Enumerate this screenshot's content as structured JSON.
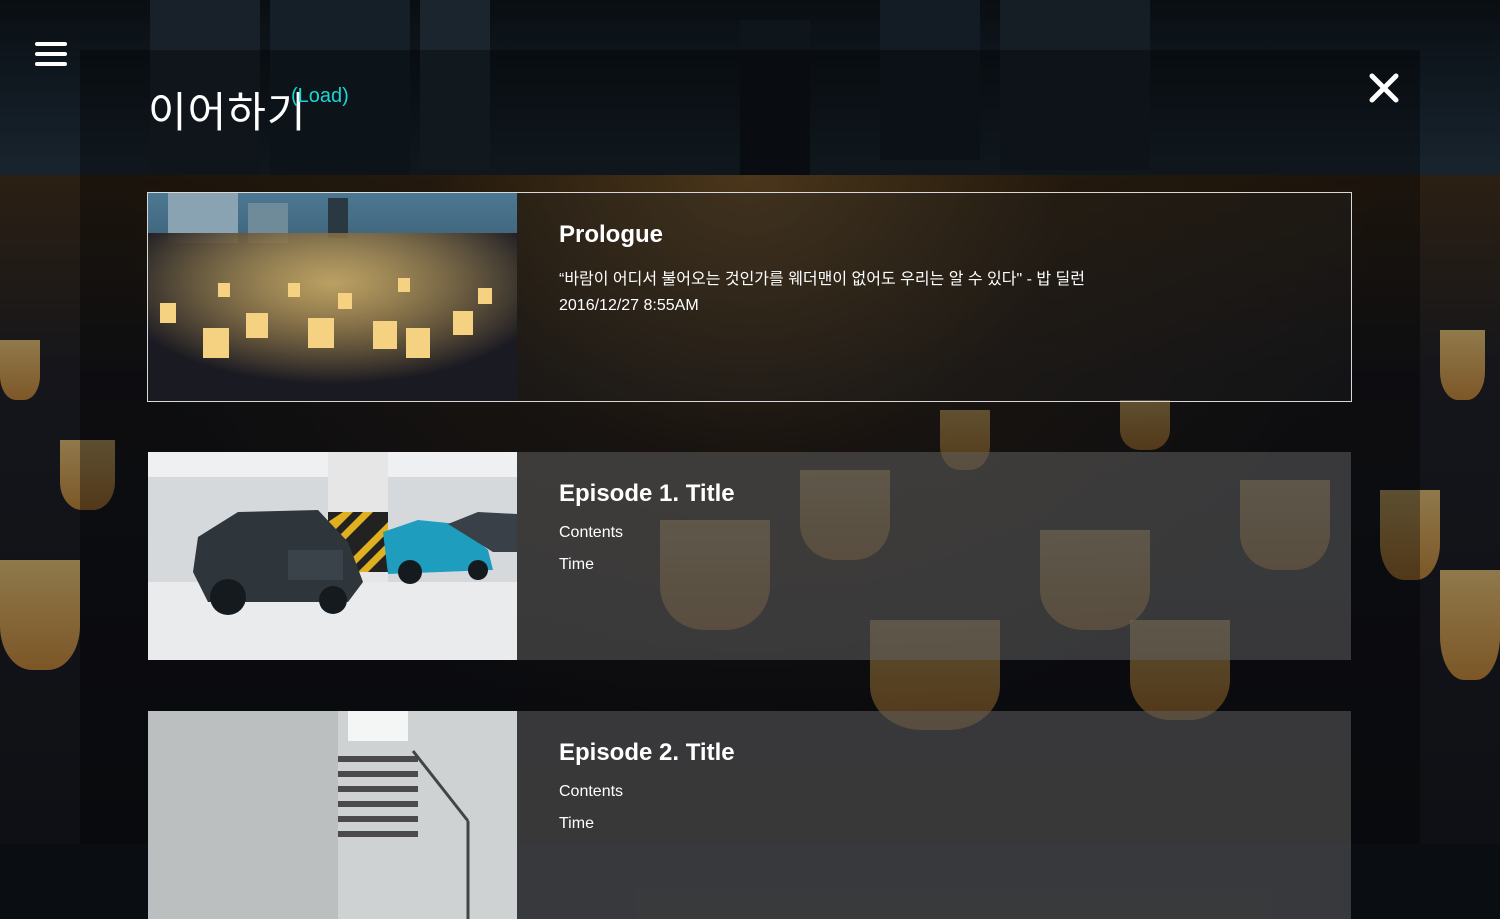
{
  "header": {
    "title": "이어하기",
    "subtitle": "(Load)"
  },
  "icons": {
    "menu": "hamburger-menu-icon",
    "close": "close-icon"
  },
  "slots": [
    {
      "title": "Prologue",
      "description": "“바람이 어디서 불어오는 것인가를 웨더맨이 없어도 우리는 알 수 있다\" - 밥 딜런",
      "time": "2016/12/27 8:55AM",
      "selected": true
    },
    {
      "title": "Episode 1. Title",
      "description": "Contents",
      "time": "Time",
      "selected": false
    },
    {
      "title": "Episode 2. Title",
      "description": "Contents",
      "time": "Time",
      "selected": false
    }
  ],
  "colors": {
    "accent": "#19d6d6",
    "selected_border": "#d8d8d8"
  }
}
